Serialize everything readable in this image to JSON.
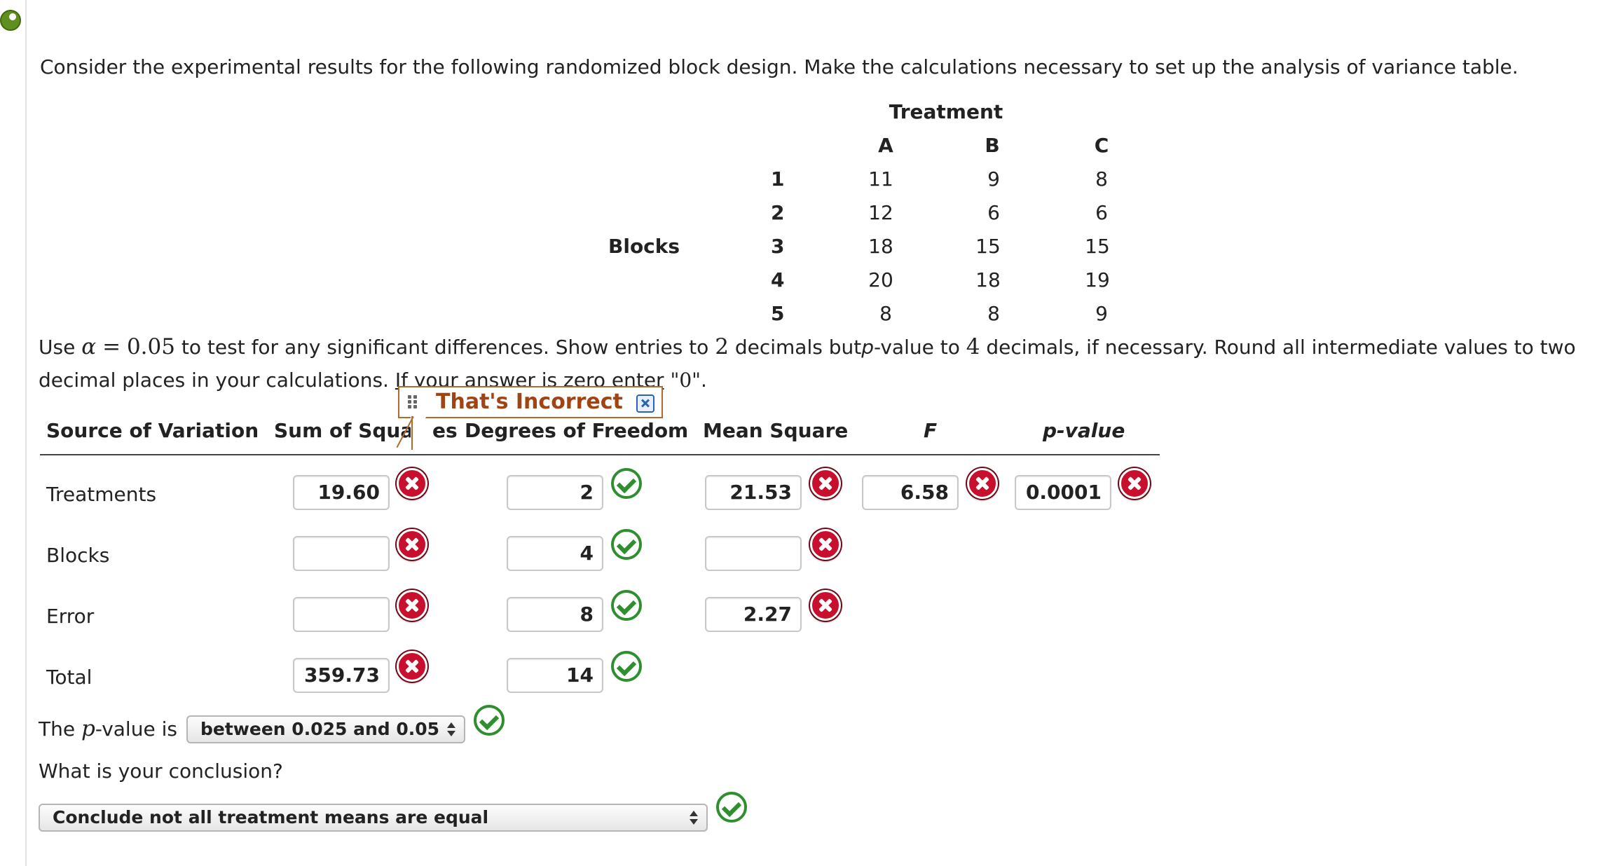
{
  "problem": {
    "intro": "Consider the experimental results for the following randomized block design. Make the calculations necessary to set up the analysis of variance table.",
    "treatment_heading": "Treatment",
    "blocks_label": "Blocks",
    "treatment_columns": [
      "A",
      "B",
      "C"
    ],
    "block_rows": [
      {
        "block": "1",
        "values": [
          "11",
          "9",
          "8"
        ]
      },
      {
        "block": "2",
        "values": [
          "12",
          "6",
          "6"
        ]
      },
      {
        "block": "3",
        "values": [
          "18",
          "15",
          "15"
        ]
      },
      {
        "block": "4",
        "values": [
          "20",
          "18",
          "19"
        ]
      },
      {
        "block": "5",
        "values": [
          "8",
          "8",
          "9"
        ]
      }
    ],
    "instructions_use": "Use",
    "alpha_symbol": "α",
    "equals": "=",
    "alpha_value": "0.05",
    "instructions_mid1": "to test for any significant differences. Show entries to",
    "decimals_entries": "2",
    "instructions_mid2": "decimals but",
    "p_italic": "p",
    "instructions_mid3": "-value to",
    "decimals_pvalue": "4",
    "instructions_mid4": "decimals, if necessary. Round all intermediate values to two",
    "instructions_line2a": "decimal places in your calculations.",
    "instructions_line2b": "If your answer is zero enter",
    "zero_hint": "\"0\"",
    "instructions_line2c": "."
  },
  "tooltip": {
    "text": "That's Incorrect",
    "close_icon": "close-icon"
  },
  "anova": {
    "headers": {
      "source": "Source of Variation",
      "ss": "Sum of Squares",
      "ss_visible_left": "Sum of Squa",
      "ss_visible_right": "es",
      "df": "Degrees of Freedom",
      "ms": "Mean Square",
      "f": "F",
      "p": "p-value"
    },
    "rows": [
      {
        "source": "Treatments",
        "ss": "19.60",
        "ss_status": "incorrect",
        "df": "2",
        "df_status": "correct",
        "ms": "21.53",
        "ms_status": "incorrect",
        "f": "6.58",
        "f_status": "incorrect",
        "p": "0.0001",
        "p_status": "incorrect"
      },
      {
        "source": "Blocks",
        "ss": "",
        "ss_status": "incorrect",
        "df": "4",
        "df_status": "correct",
        "ms": "",
        "ms_status": "incorrect"
      },
      {
        "source": "Error",
        "ss": "",
        "ss_status": "incorrect",
        "df": "8",
        "df_status": "correct",
        "ms": "2.27",
        "ms_status": "incorrect"
      },
      {
        "source": "Total",
        "ss": "359.73",
        "ss_status": "incorrect",
        "df": "14",
        "df_status": "correct"
      }
    ]
  },
  "pvalue_question": {
    "prefix": "The",
    "p_symbol": "p",
    "suffix": "-value is",
    "selected": "between 0.025 and 0.05",
    "status": "correct"
  },
  "conclusion_question": {
    "label": "What is your conclusion?",
    "selected": "Conclude not all treatment means are equal",
    "status": "correct"
  },
  "colors": {
    "incorrect": "#c8102e",
    "correct": "#2f8f2f",
    "tooltip_text": "#a04414",
    "tooltip_border": "#b06a2e"
  }
}
